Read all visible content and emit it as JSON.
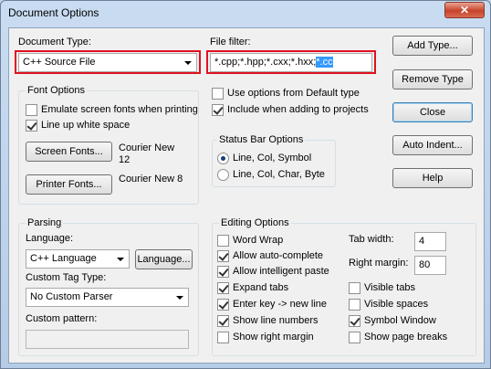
{
  "window": {
    "title": "Document Options",
    "close_glyph": "✕"
  },
  "document_type": {
    "label": "Document Type:",
    "value": "C++ Source File"
  },
  "file_filter": {
    "label": "File filter:",
    "value_plain": "*.cpp;*.hpp;*.cxx;*.hxx;",
    "value_selected": "*.cc"
  },
  "buttons": {
    "add_type": "Add Type...",
    "remove_type": "Remove Type",
    "close": "Close",
    "auto_indent": "Auto Indent...",
    "help": "Help"
  },
  "font_options": {
    "title": "Font Options",
    "emulate_screen_fonts": {
      "label": "Emulate screen fonts when printing",
      "checked": false
    },
    "line_up_white_space": {
      "label": "Line up white space",
      "checked": true
    },
    "screen_fonts_button": "Screen Fonts...",
    "screen_font_name": "Courier New",
    "screen_font_size": "12",
    "printer_fonts_button": "Printer Fonts...",
    "printer_font": "Courier New 8"
  },
  "options": {
    "use_defaults": {
      "label": "Use options from Default type",
      "checked": false
    },
    "include_projects": {
      "label": "Include when adding to projects",
      "checked": true
    }
  },
  "status_bar": {
    "title": "Status Bar Options",
    "opt1": {
      "label": "Line, Col, Symbol",
      "selected": true
    },
    "opt2": {
      "label": "Line, Col, Char, Byte",
      "selected": false
    }
  },
  "parsing": {
    "title": "Parsing",
    "language_label": "Language:",
    "language_value": "C++ Language",
    "language_button": "Language...",
    "custom_tag_label": "Custom Tag Type:",
    "custom_tag_value": "No Custom Parser",
    "custom_pattern_label": "Custom pattern:"
  },
  "editing": {
    "title": "Editing Options",
    "word_wrap": {
      "label": "Word Wrap",
      "checked": false
    },
    "allow_auto_complete": {
      "label": "Allow auto-complete",
      "checked": true
    },
    "allow_intelligent_paste": {
      "label": "Allow intelligent paste",
      "checked": true
    },
    "expand_tabs": {
      "label": "Expand tabs",
      "checked": true
    },
    "enter_key_new_line": {
      "label": "Enter key -> new line",
      "checked": true
    },
    "show_line_numbers": {
      "label": "Show line numbers",
      "checked": true
    },
    "show_right_margin": {
      "label": "Show right margin",
      "checked": false
    },
    "tab_width_label": "Tab width:",
    "tab_width_value": "4",
    "right_margin_label": "Right margin:",
    "right_margin_value": "80",
    "visible_tabs": {
      "label": "Visible tabs",
      "checked": false
    },
    "visible_spaces": {
      "label": "Visible spaces",
      "checked": false
    },
    "symbol_window": {
      "label": "Symbol Window",
      "checked": true
    },
    "show_page_breaks": {
      "label": "Show page breaks",
      "checked": false
    }
  }
}
